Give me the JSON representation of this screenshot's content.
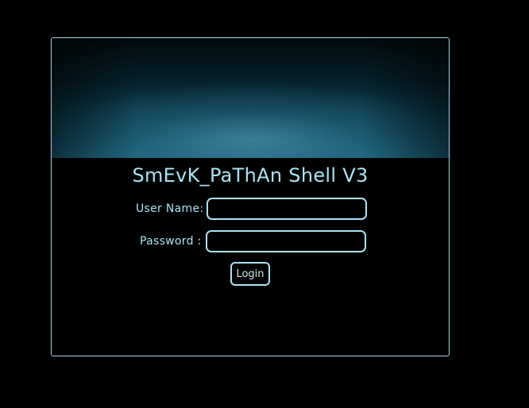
{
  "login_panel": {
    "title": "SmEvK_PaThAn Shell V3",
    "username_label": "User Name:",
    "username_value": "",
    "password_label": "Password :",
    "password_value": "",
    "login_button": "Login"
  },
  "colors": {
    "page_background": "#000000",
    "accent_text": "#a9e4f4",
    "panel_border": "#9fd6e6",
    "banner_glow": "#1d6e88"
  }
}
